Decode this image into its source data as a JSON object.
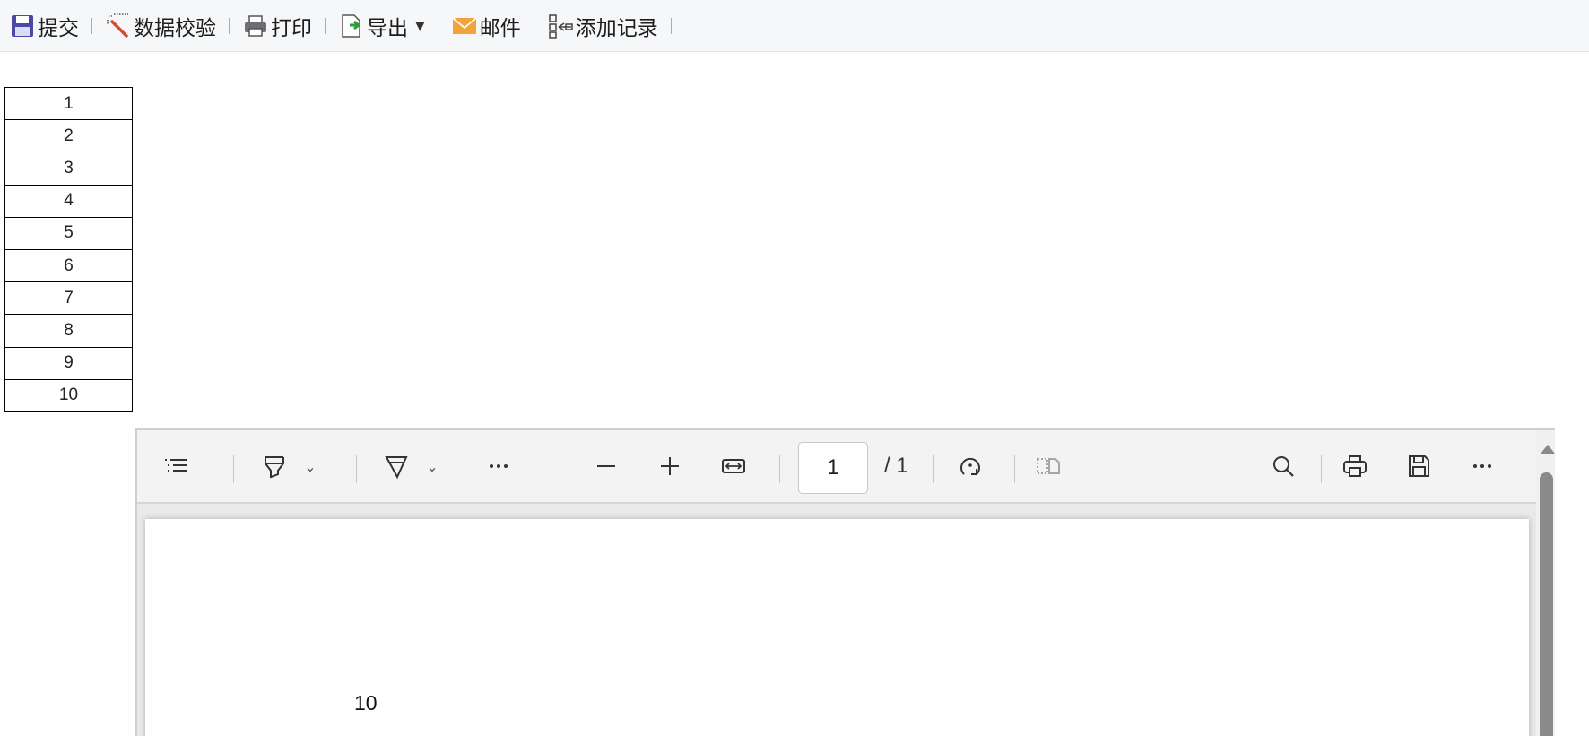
{
  "toolbar": {
    "submit": {
      "label": "提交",
      "icon": "save-icon"
    },
    "validate": {
      "label": "数据校验",
      "icon": "magic-wand-icon"
    },
    "print": {
      "label": "打印",
      "icon": "printer-icon"
    },
    "export": {
      "label": "导出",
      "icon": "export-icon",
      "has_dropdown": true
    },
    "mail": {
      "label": "邮件",
      "icon": "envelope-icon"
    },
    "add_record": {
      "label": "添加记录",
      "icon": "add-record-icon"
    }
  },
  "row_numbers": [
    "1",
    "2",
    "3",
    "4",
    "5",
    "6",
    "7",
    "8",
    "9",
    "10"
  ],
  "pdf_viewer": {
    "current_page": "1",
    "total_pages": "/ 1",
    "page_content_text": "10",
    "icons": [
      "contents-icon",
      "highlight-icon",
      "draw-icon",
      "more-icon",
      "zoom-out-icon",
      "zoom-in-icon",
      "fit-width-icon",
      "rotate-icon",
      "two-page-icon",
      "search-icon",
      "print-icon",
      "save-icon",
      "more-options-icon"
    ]
  },
  "colors": {
    "toolbar_bg": "#f6f7f9",
    "viewer_toolbar_bg": "#f3f3f3",
    "viewer_bg": "#e9e9e9",
    "submit_icon": "#4a4aa6",
    "mail_icon": "#f2a33a",
    "export_arrow": "#2e9b3c"
  }
}
